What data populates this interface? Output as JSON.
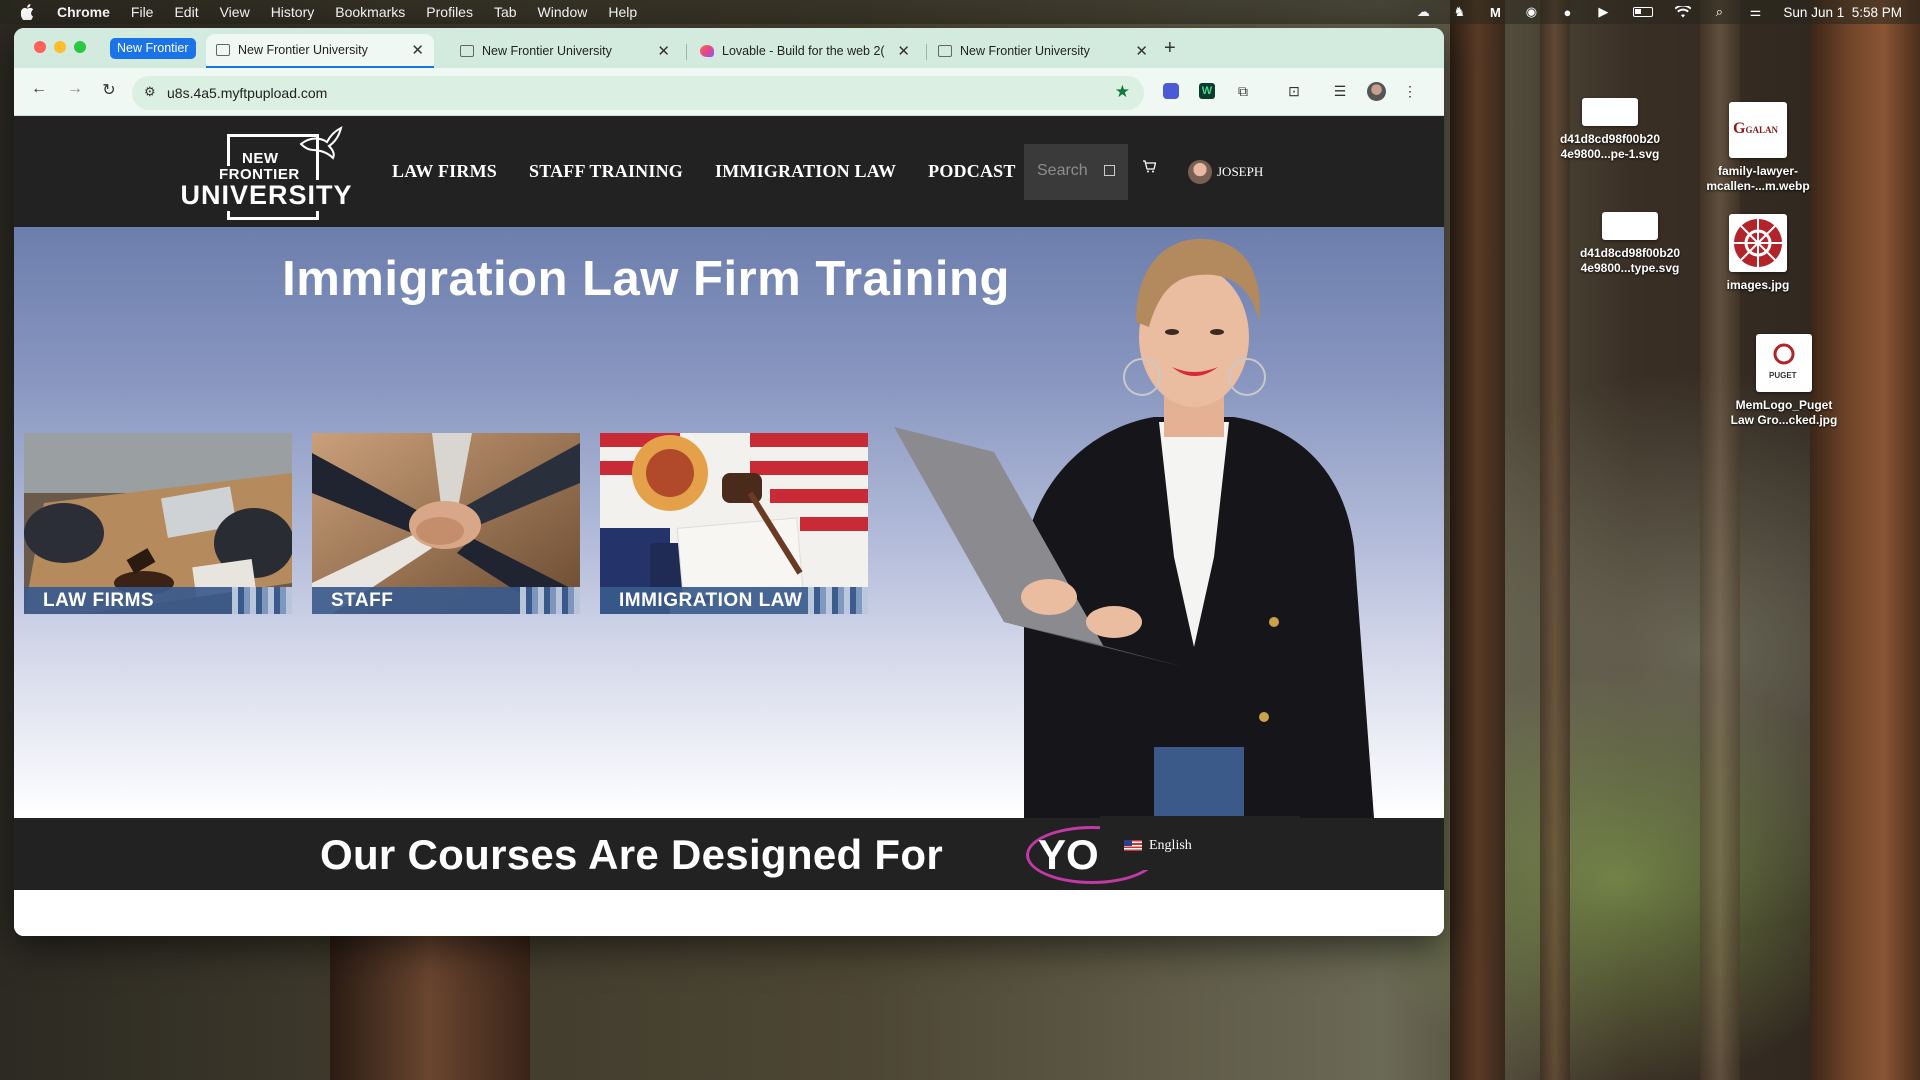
{
  "menubar": {
    "app_name": "Chrome",
    "menus": [
      "File",
      "Edit",
      "View",
      "History",
      "Bookmarks",
      "Profiles",
      "Tab",
      "Window",
      "Help"
    ],
    "clock": "Sun Jun 1  5:58 PM"
  },
  "browser": {
    "tab_group_label": "New Frontier",
    "tabs": [
      {
        "title": "New Frontier University",
        "active": true
      },
      {
        "title": "New Frontier University",
        "active": false
      },
      {
        "title": "Lovable - Build for the web 2(",
        "active": false
      },
      {
        "title": "New Frontier University",
        "active": false
      }
    ],
    "url": "u8s.4a5.myftpupload.com"
  },
  "site": {
    "logo": {
      "line1": "NEW",
      "line2": "FRONTIER",
      "line3": "UNIVERSITY"
    },
    "nav": [
      "LAW FIRMS",
      "STAFF TRAINING",
      "IMMIGRATION LAW",
      "PODCAST"
    ],
    "search_placeholder": "Search",
    "user_name": "JOSEPH",
    "hero_title": "Immigration Law Firm Training",
    "cards": [
      "LAW FIRMS",
      "STAFF",
      "IMMIGRATION LAW"
    ],
    "courses_heading": "Our Courses Are Designed For",
    "courses_highlight": "YOU!",
    "language": "English"
  },
  "desktop": {
    "icons": [
      {
        "name": "d41d8cd98f00b20\n4e9800...pe-1.svg"
      },
      {
        "name": "family-lawyer-\nmcallen-...m.webp"
      },
      {
        "name": "d41d8cd98f00b20\n4e9800...type.svg"
      },
      {
        "name": "images.jpg"
      },
      {
        "name": "MemLogo_Puget\nLaw Gro...cked.jpg"
      }
    ],
    "thumb_text": {
      "galan": "GALAN",
      "puget": "PUGET"
    }
  },
  "colors": {
    "header_bg": "#222222",
    "hero_top": "#6c7ead",
    "accent_blue": "#1a73e8",
    "highlight_ring": "#c13aa6",
    "tab_strip": "#d3ebde"
  }
}
